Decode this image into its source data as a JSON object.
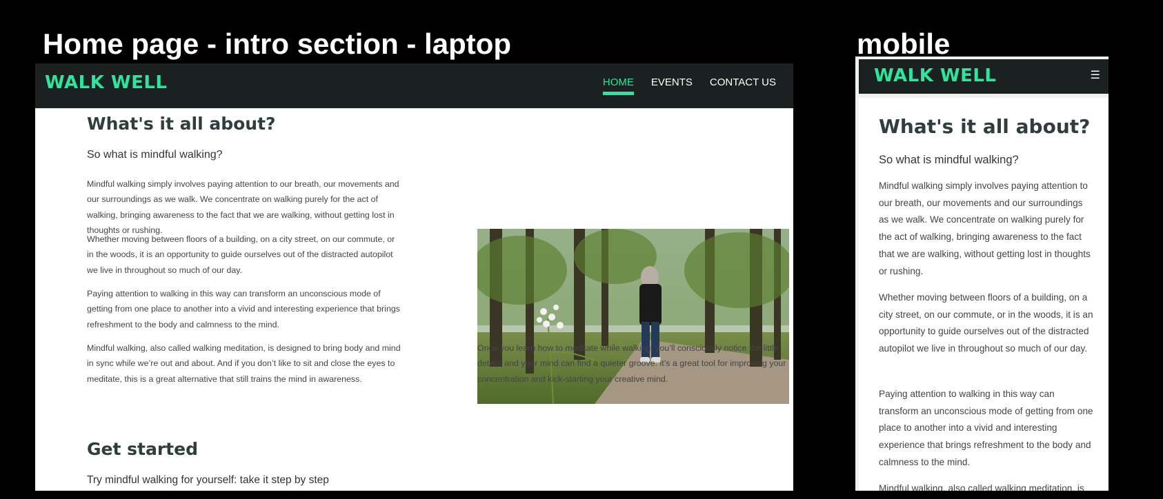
{
  "captions": {
    "laptop": "Home page - intro section - laptop",
    "mobile": "mobile"
  },
  "brand": {
    "name": "WALK WELL",
    "accent_color": "#2ee59d",
    "nav_bg": "#1b2120"
  },
  "nav": {
    "items": [
      {
        "label": "HOME",
        "active": true
      },
      {
        "label": "EVENTS",
        "active": false
      },
      {
        "label": "CONTACT US",
        "active": false
      }
    ],
    "menu_icon": "hamburger-icon"
  },
  "intro": {
    "heading": "What's it all about?",
    "subheading": "So what is mindful walking?",
    "paragraphs": [
      "Mindful walking simply involves paying attention to our breath, our movements and our surroundings as we walk. We concentrate on walking purely for the act of walking, bringing awareness to the fact that we are walking, without getting lost in thoughts or rushing.",
      "Whether moving between floors of a building, on a city street, on our commute, or in the woods, it is an opportunity to guide ourselves out of the distracted autopilot we live in throughout so much of our day.",
      "Paying attention to walking in this way can transform an unconscious mode of getting from one place to another into a vivid and interesting experience that brings refreshment to the body and calmness to the mind.",
      "Mindful walking, also called walking meditation, is designed to bring body and mind in sync while we’re out and about. And if you don’t like to sit and close the eyes to meditate, this is a great alternative that still trains the mind in awareness."
    ],
    "photo_caption": "Once you learn how to meditate while walking, you’ll consciously notice the little details and your mind can find a quieter groove. it’s a great tool for improving your concentration and kick-starting your creative mind.",
    "photo_icon": "woman-walking-in-forest-photo"
  },
  "get_started": {
    "heading": "Get started",
    "subheading": "Try mindful walking for yourself: take it step by step"
  },
  "mobile_partial_line": "Mindful walking, also called walking meditation, is"
}
